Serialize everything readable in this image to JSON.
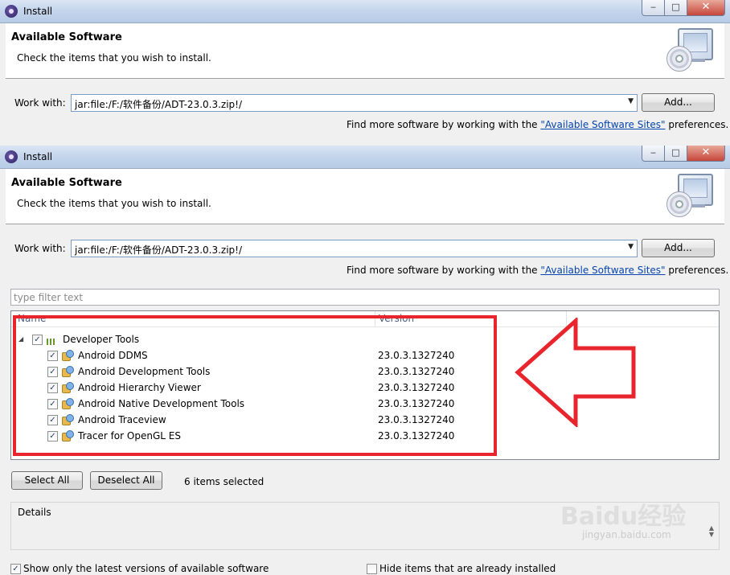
{
  "windows": [
    {
      "title": "Install",
      "banner": {
        "title": "Available Software",
        "description": "Check the items that you wish to install."
      },
      "work_with": {
        "label": "Work with:",
        "value": "jar:file:/F:/软件备份/ADT-23.0.3.zip!/"
      },
      "add_button": "Add...",
      "find_more": {
        "prefix": "Find more software by working with the ",
        "link": "\"Available Software Sites\"",
        "suffix": " preferences."
      }
    },
    {
      "title": "Install",
      "banner": {
        "title": "Available Software",
        "description": "Check the items that you wish to install."
      },
      "work_with": {
        "label": "Work with:",
        "value": "jar:file:/F:/软件备份/ADT-23.0.3.zip!/"
      },
      "add_button": "Add...",
      "find_more": {
        "prefix": "Find more software by working with the ",
        "link": "\"Available Software Sites\"",
        "suffix": " preferences."
      },
      "filter_placeholder": "type filter text",
      "table": {
        "columns": [
          "Name",
          "Version"
        ],
        "category": {
          "name": "Developer Tools",
          "expanded": true,
          "checked": true
        },
        "rows": [
          {
            "name": "Android DDMS",
            "version": "23.0.3.1327240",
            "checked": true
          },
          {
            "name": "Android Development Tools",
            "version": "23.0.3.1327240",
            "checked": true
          },
          {
            "name": "Android Hierarchy Viewer",
            "version": "23.0.3.1327240",
            "checked": true
          },
          {
            "name": "Android Native Development Tools",
            "version": "23.0.3.1327240",
            "checked": true
          },
          {
            "name": "Android Traceview",
            "version": "23.0.3.1327240",
            "checked": true
          },
          {
            "name": "Tracer for OpenGL ES",
            "version": "23.0.3.1327240",
            "checked": true
          }
        ]
      },
      "select_all": "Select All",
      "deselect_all": "Deselect All",
      "selection_status": "6 items selected",
      "details_label": "Details",
      "options": {
        "show_latest": {
          "label": "Show only the latest versions of available software",
          "checked": true
        },
        "hide_installed": {
          "label": "Hide items that are already installed",
          "checked": false
        }
      }
    }
  ],
  "watermark": {
    "logo": "Baidu经验",
    "url": "jingyan.baidu.com"
  },
  "colors": {
    "highlight_box": "#e8242c",
    "link": "#0645ad",
    "arrow": "#e8242c"
  },
  "icons": [
    "app-icon",
    "minimize-icon",
    "maximize-icon",
    "close-icon",
    "install-banner-icon",
    "dropdown-arrow-icon",
    "expand-icon",
    "category-icon",
    "feature-icon",
    "checkbox-icon"
  ]
}
